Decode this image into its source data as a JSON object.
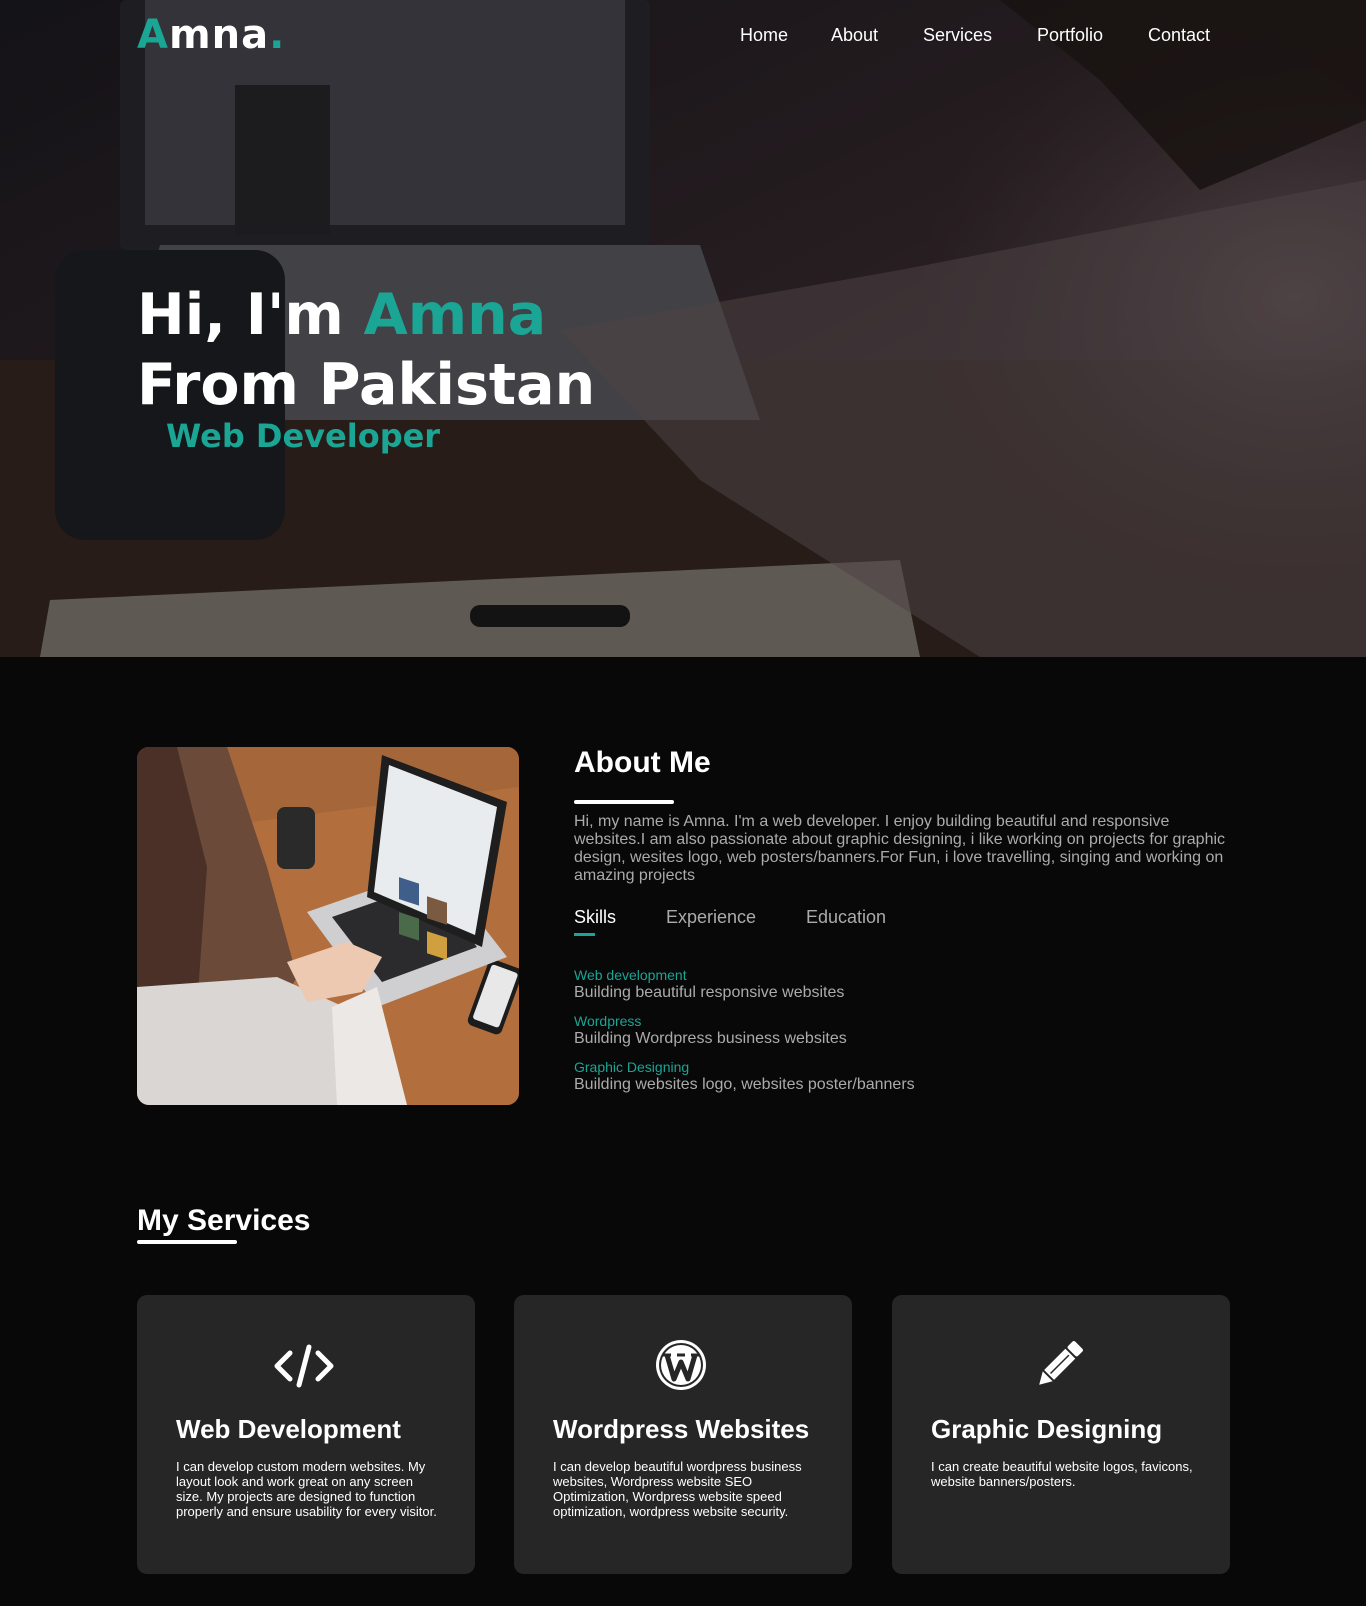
{
  "brand": {
    "first_letter": "A",
    "rest": "mna",
    "dot": ".",
    "accent_color": "#1aa594"
  },
  "nav": {
    "items": [
      {
        "label": "Home"
      },
      {
        "label": "About"
      },
      {
        "label": "Services"
      },
      {
        "label": "Portfolio"
      },
      {
        "label": "Contact"
      }
    ]
  },
  "hero": {
    "greeting": "Hi, I'm ",
    "name": "Amna",
    "line2": "From Pakistan",
    "role": "Web Developer",
    "background": "laptop-desk-photo"
  },
  "about": {
    "title": "About Me",
    "text": "Hi, my name is Amna. I'm a web developer. I enjoy building beautiful and responsive websites.I am also passionate about graphic designing, i like working on projects for graphic design, wesites logo, web posters/banners.For Fun, i love travelling, singing and working on amazing projects",
    "photo": "woman-using-laptop-photo",
    "tabs": [
      {
        "label": "Skills",
        "active": true
      },
      {
        "label": "Experience",
        "active": false
      },
      {
        "label": "Education",
        "active": false
      }
    ],
    "skills": [
      {
        "name": "Web development",
        "desc": "Building beautiful responsive websites"
      },
      {
        "name": "Wordpress",
        "desc": "Building Wordpress business websites"
      },
      {
        "name": "Graphic Designing",
        "desc": "Building websites logo, websites poster/banners"
      }
    ]
  },
  "services": {
    "title": "My Services",
    "items": [
      {
        "icon": "code-icon",
        "title": "Web Development",
        "text": "I can develop custom modern websites. My layout look and work great on any screen size. My projects are designed to function properly and ensure usability for every visitor."
      },
      {
        "icon": "wordpress-icon",
        "title": "Wordpress Websites",
        "text": "I can develop beautiful wordpress business websites, Wordpress website SEO Optimization, Wordpress website speed optimization, wordpress website security."
      },
      {
        "icon": "pencil-icon",
        "title": "Graphic Designing",
        "text": "I can create beautiful website logos, favicons, website banners/posters."
      }
    ]
  }
}
